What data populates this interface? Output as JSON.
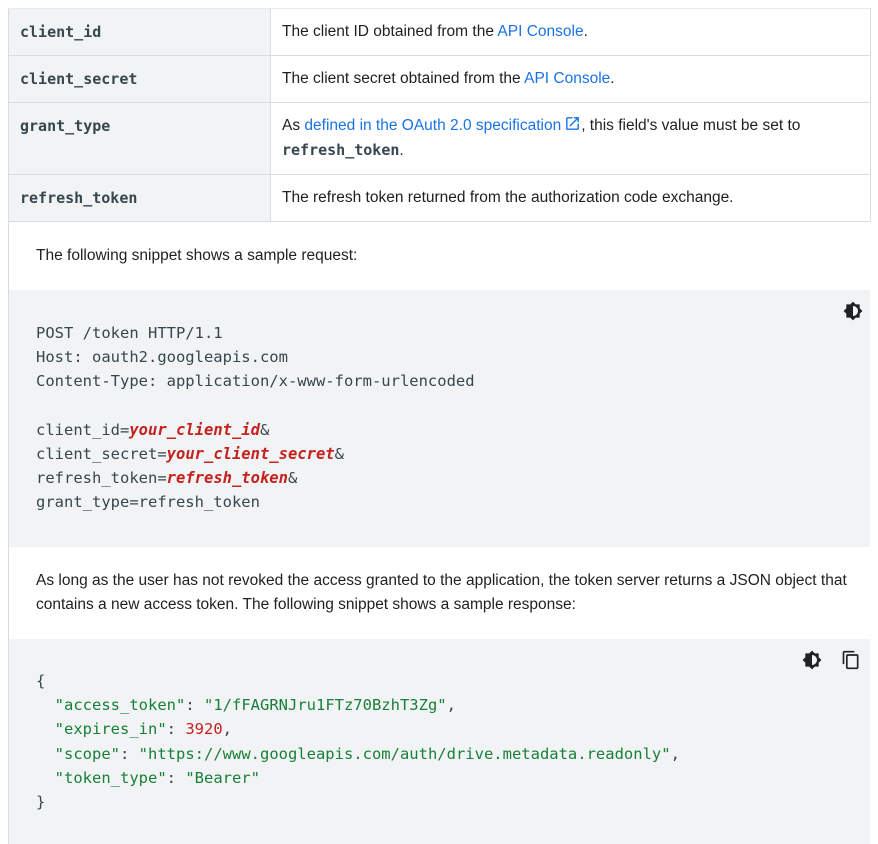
{
  "params": [
    {
      "name": "client_id",
      "desc_before": "The client ID obtained from the ",
      "link": "API Console",
      "desc_after": "."
    },
    {
      "name": "client_secret",
      "desc_before": "The client secret obtained from the ",
      "link": "API Console",
      "desc_after": "."
    },
    {
      "name": "grant_type",
      "desc_before": "As ",
      "link": "defined in the OAuth 2.0 specification",
      "desc_mid": ", this field's value must be set to ",
      "code": "refresh_token",
      "desc_after": "."
    },
    {
      "name": "refresh_token",
      "desc_before": "The refresh token returned from the authorization code exchange."
    }
  ],
  "request_intro": "The following snippet shows a sample request:",
  "request": {
    "line1": "POST /token HTTP/1.1",
    "line2": "Host: oauth2.googleapis.com",
    "line3": "Content-Type: application/x-www-form-urlencoded",
    "k1": "client_id=",
    "v1": "your_client_id",
    "amp1": "&",
    "k2": "client_secret=",
    "v2": "your_client_secret",
    "amp2": "&",
    "k3": "refresh_token=",
    "v3": "refresh_token",
    "amp3": "&",
    "line7": "grant_type=refresh_token"
  },
  "response_intro": "As long as the user has not revoked the access granted to the application, the token server returns a JSON object that contains a new access token. The following snippet shows a sample response:",
  "response": {
    "open": "{",
    "k1": "\"access_token\"",
    "v1": "\"1/fFAGRNJru1FTz70BzhT3Zg\"",
    "k2": "\"expires_in\"",
    "v2": "3920",
    "k3": "\"scope\"",
    "v3": "\"https://www.googleapis.com/auth/drive.metadata.readonly\"",
    "k4": "\"token_type\"",
    "v4": "\"Bearer\"",
    "close": "}"
  },
  "icons": {
    "theme": "dark-mode-icon",
    "copy": "copy-icon",
    "external": "external-link-icon"
  }
}
